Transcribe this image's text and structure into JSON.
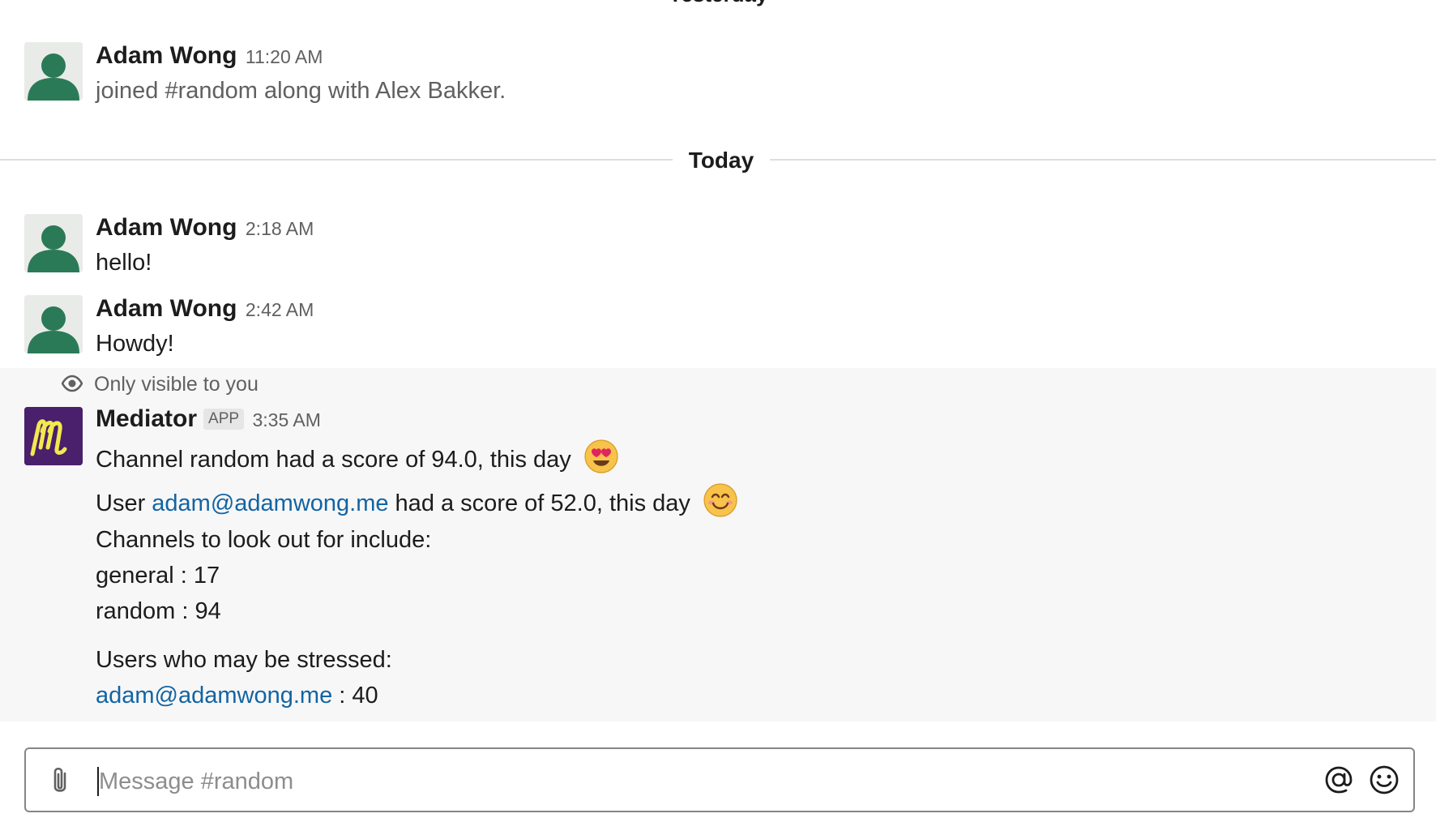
{
  "top_cut_label": "Yesterday",
  "messages_before": [
    {
      "author": "Adam Wong",
      "time": "11:20 AM",
      "text": "joined #random along with Alex Bakker."
    }
  ],
  "divider": {
    "label": "Today"
  },
  "messages_today": [
    {
      "author": "Adam Wong",
      "time": "2:18 AM",
      "text": "hello!"
    },
    {
      "author": "Adam Wong",
      "time": "2:42 AM",
      "text": "Howdy!"
    }
  ],
  "ephemeral": {
    "visibility_note": "Only visible to you",
    "author": "Mediator",
    "badge": "APP",
    "time": "3:35 AM",
    "line1": {
      "text": "Channel random had a score of 94.0, this day",
      "emoji": "heart-eyes-emoji"
    },
    "line2": {
      "prefix": "User ",
      "link": "adam@adamwong.me",
      "suffix": " had a score of 52.0, this day",
      "emoji": "smiling-emoji"
    },
    "channels_header": "Channels to look out for include:",
    "channels": [
      {
        "name": "general",
        "sep": " : ",
        "score": "17"
      },
      {
        "name": "random",
        "sep": " : ",
        "score": "94"
      }
    ],
    "users_header": "Users who may be stressed:",
    "users": [
      {
        "link": "adam@adamwong.me",
        "sep": " : ",
        "score": "40"
      }
    ]
  },
  "composer": {
    "placeholder": "Message #random",
    "icons": [
      "paperclip-icon",
      "at-icon",
      "emoji-icon"
    ]
  },
  "colors": {
    "avatar_green": "#2b7a57",
    "link": "#1264a3",
    "app_avatar_bg": "#4a1f6b",
    "app_avatar_letter": "#f2e94e",
    "ephemeral_bg": "#f7f7f7"
  }
}
